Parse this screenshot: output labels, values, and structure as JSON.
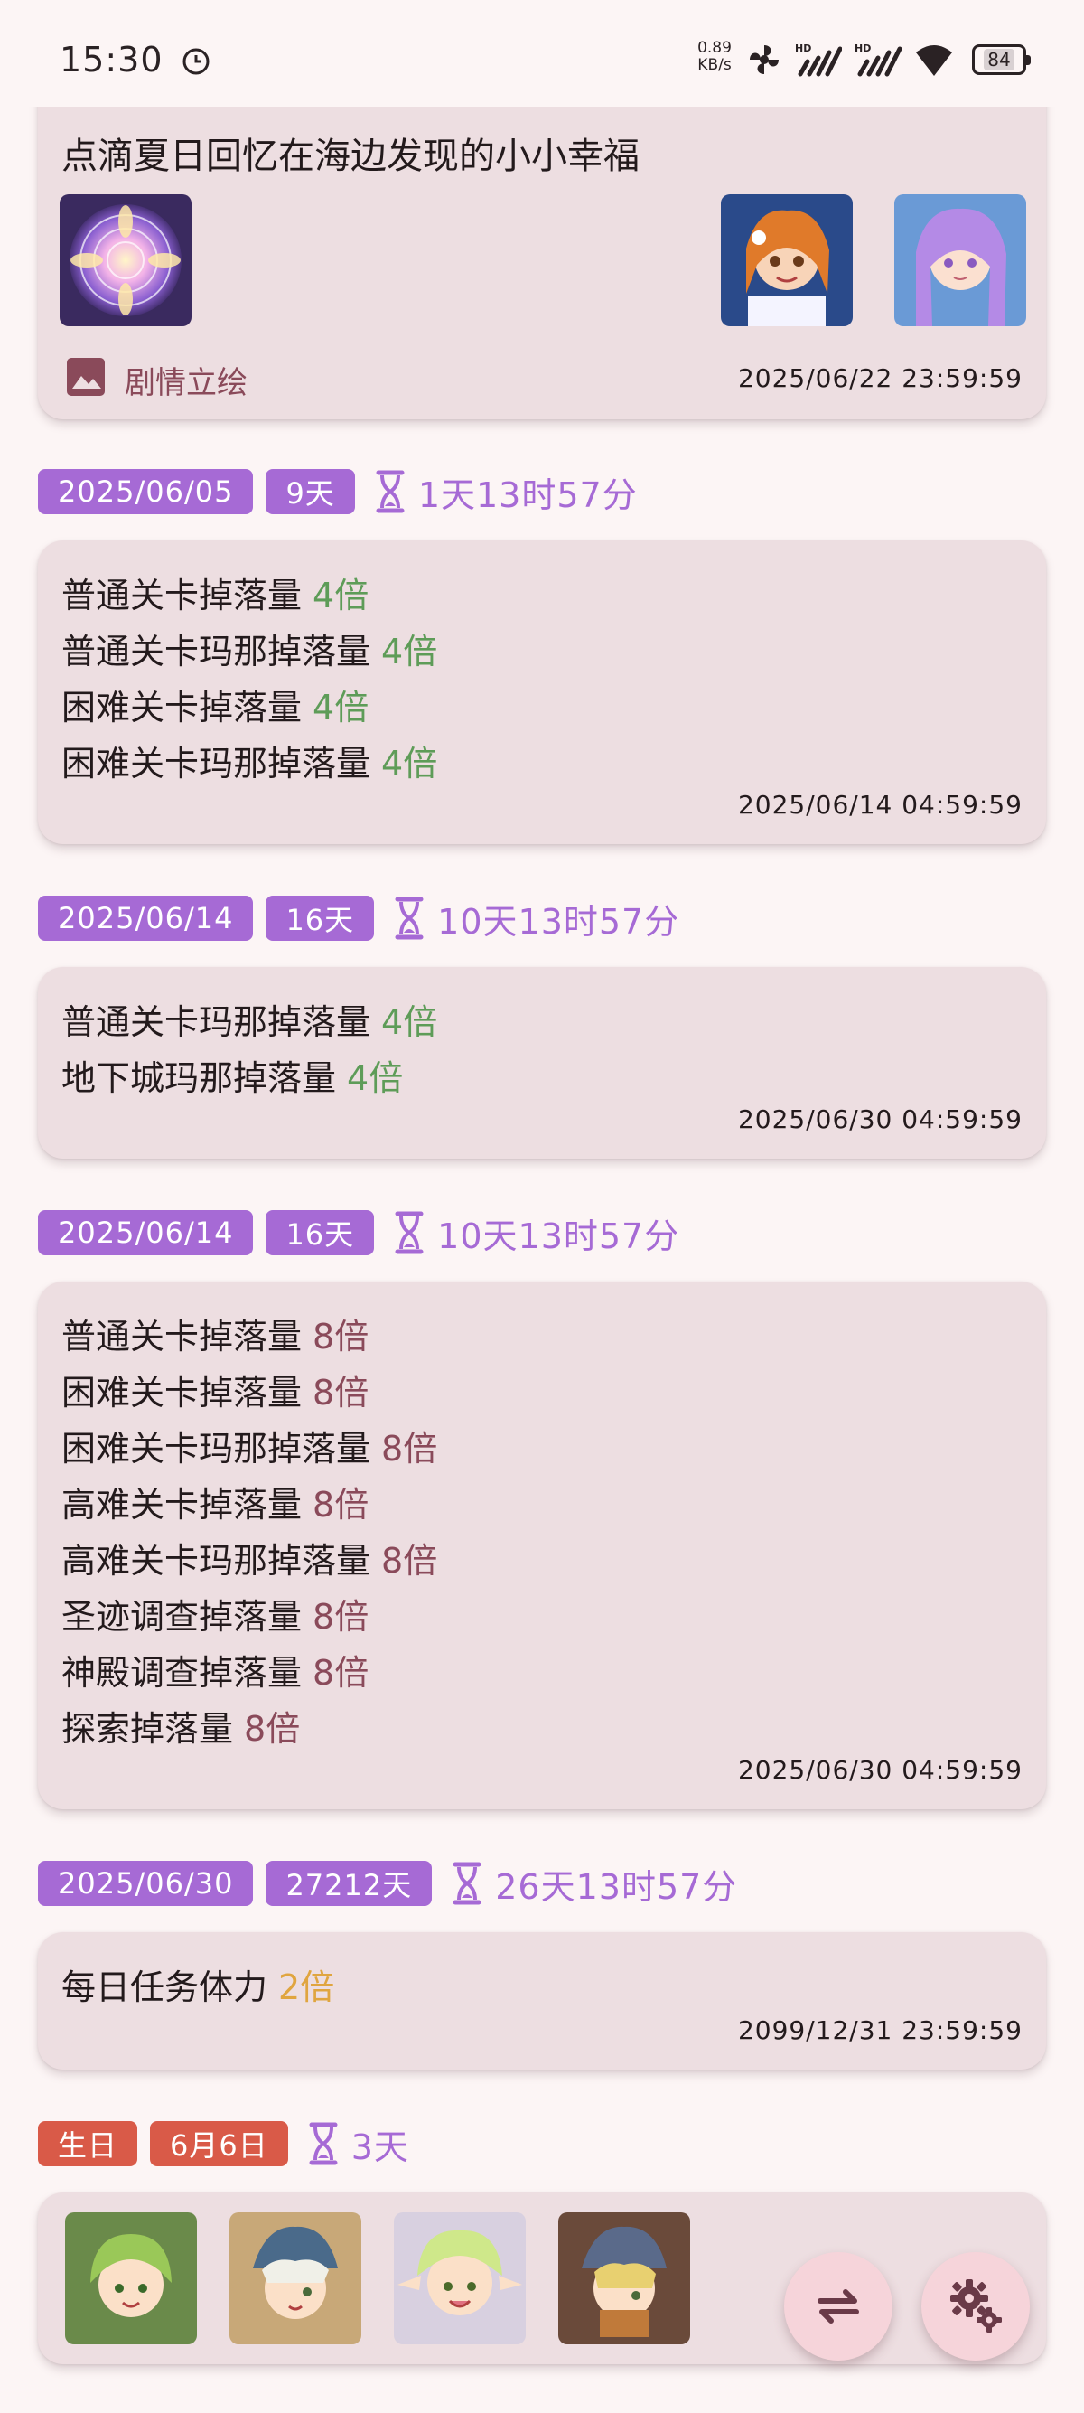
{
  "status_bar": {
    "time": "15:30",
    "net_speed_value": "0.89",
    "net_speed_unit": "KB/s",
    "signal_badges": [
      "HD",
      "HD"
    ],
    "battery": "84"
  },
  "top_card": {
    "title": "点滴夏日回忆在海边发现的小小幸福",
    "story_label": "剧情立绘",
    "time": "2025/06/22 23:59:59",
    "images": [
      "flower-emblem-image",
      "character-portrait-1",
      "character-portrait-2"
    ]
  },
  "sections": [
    {
      "date": "2025/06/05",
      "duration": "9天",
      "countdown": "1天13时57分",
      "lines": [
        {
          "label": "普通关卡掉落量",
          "mult": "4倍"
        },
        {
          "label": "普通关卡玛那掉落量",
          "mult": "4倍"
        },
        {
          "label": "困难关卡掉落量",
          "mult": "4倍"
        },
        {
          "label": "困难关卡玛那掉落量",
          "mult": "4倍"
        }
      ],
      "time": "2025/06/14 04:59:59"
    },
    {
      "date": "2025/06/14",
      "duration": "16天",
      "countdown": "10天13时57分",
      "lines": [
        {
          "label": "普通关卡玛那掉落量",
          "mult": "4倍"
        },
        {
          "label": "地下城玛那掉落量",
          "mult": "4倍"
        }
      ],
      "time": "2025/06/30 04:59:59"
    },
    {
      "date": "2025/06/14",
      "duration": "16天",
      "countdown": "10天13时57分",
      "lines": [
        {
          "label": "普通关卡掉落量",
          "mult": "8倍"
        },
        {
          "label": "困难关卡掉落量",
          "mult": "8倍"
        },
        {
          "label": "困难关卡玛那掉落量",
          "mult": "8倍"
        },
        {
          "label": "高难关卡掉落量",
          "mult": "8倍"
        },
        {
          "label": "高难关卡玛那掉落量",
          "mult": "8倍"
        },
        {
          "label": "圣迹调查掉落量",
          "mult": "8倍"
        },
        {
          "label": "神殿调查掉落量",
          "mult": "8倍"
        },
        {
          "label": "探索掉落量",
          "mult": "8倍"
        }
      ],
      "time": "2025/06/30 04:59:59"
    },
    {
      "date": "2025/06/30",
      "duration": "27212天",
      "countdown": "26天13时57分",
      "lines": [
        {
          "label": "每日任务体力",
          "mult": "2倍"
        }
      ],
      "time": "2099/12/31 23:59:59"
    }
  ],
  "birthday": {
    "tag": "生日",
    "date": "6月6日",
    "countdown": "3天",
    "avatars": [
      "character-avatar-1",
      "character-avatar-2",
      "character-avatar-3",
      "character-avatar-4"
    ]
  },
  "colors": {
    "accent": "#a66ad5",
    "birthday": "#d95a48",
    "card_bg": "#eddee1",
    "mult_green": "#5e9c58",
    "mult_red": "#8a4a5a",
    "mult_orange": "#e0a53f",
    "fab_bg": "#f6d4da"
  },
  "fabs": {
    "swap_icon": "swap-arrows-icon",
    "settings_icon": "gears-icon"
  }
}
